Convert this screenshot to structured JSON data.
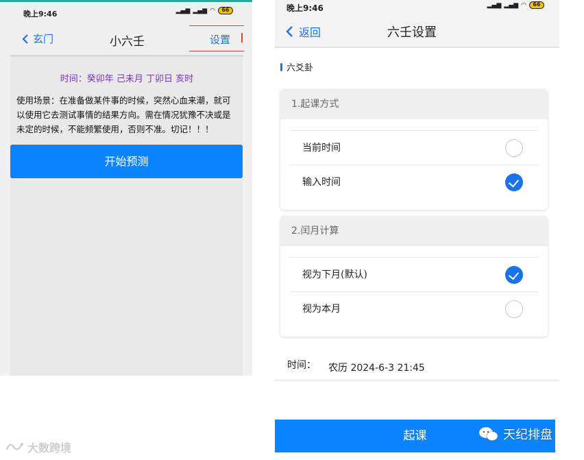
{
  "left": {
    "status": {
      "time": "晚上9:46",
      "battery": "66"
    },
    "nav": {
      "back": "玄门",
      "title": "小六壬",
      "setting": "设置"
    },
    "time_text": "时间：癸卯年 己未月 丁卯日 亥时",
    "description": "使用场景：在准备做某件事的时候，突然心血来潮，就可以使用它去测试事情的结果方向。需在情况犹豫不决或是未定的时候，不能频繁使用，否则不准。切记！！！",
    "start_button": "开始预测"
  },
  "right": {
    "status": {
      "time": "晚上9:46",
      "battery": "66"
    },
    "nav": {
      "back": "返回",
      "title": "六壬设置"
    },
    "section": "六爻卦",
    "card1": {
      "header": "1.起课方式",
      "options": [
        {
          "label": "当前时间",
          "checked": false
        },
        {
          "label": "输入时间",
          "checked": true
        }
      ]
    },
    "card2": {
      "header": "2.闰月计算",
      "options": [
        {
          "label": "视为下月(默认)",
          "checked": true
        },
        {
          "label": "视为本月",
          "checked": false
        }
      ]
    },
    "time_label": "时间：",
    "time_value": "农历 2024-6-3 21:45",
    "submit_button": "起课"
  },
  "watermarks": {
    "left": "大数跨境",
    "right": "天纪排盘"
  },
  "colors": {
    "accent": "#1a73e8",
    "button": "#0a84ff",
    "time_purple": "#7b2fd0",
    "highlight": "#e04040"
  }
}
